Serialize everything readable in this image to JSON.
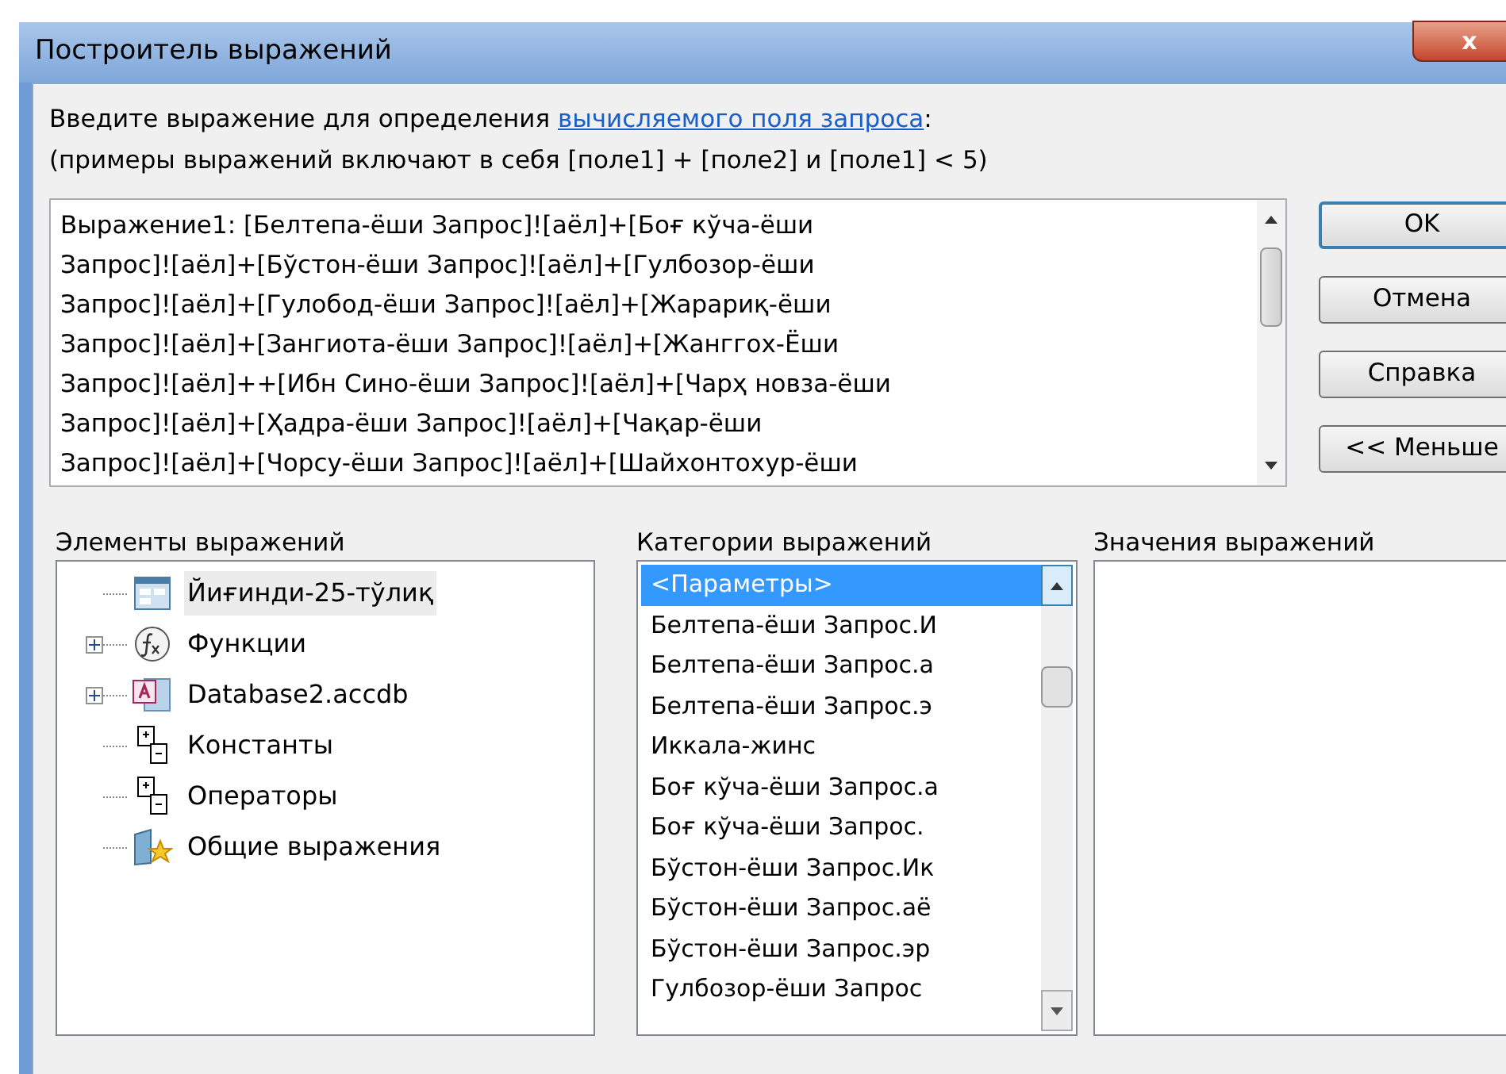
{
  "window": {
    "title": "Построитель выражений",
    "close": "x"
  },
  "instruction": {
    "before": "Введите выражение для определения ",
    "link": "вычисляемого поля запроса",
    "after": ":"
  },
  "example": "(примеры выражений включают в себя [поле1] + [поле2] и [поле1] < 5)",
  "expression_lines": [
    "Выражение1: [Белтепа-ёши Запрос]![аёл]+[Боғ кўча-ёши",
    "Запрос]![аёл]+[Бўстон-ёши Запрос]![аёл]+[Гулбозор-ёши",
    "Запрос]![аёл]+[Гулобод-ёши Запрос]![аёл]+[Жарариқ-ёши",
    "Запрос]![аёл]+[Зангиота-ёши Запрос]![аёл]+[Жанггох-Ёши",
    "Запрос]![аёл]++[Ибн Сино-ёши Запрос]![аёл]+[Чарҳ новза-ёши",
    "Запрос]![аёл]+[Ҳадра-ёши Запрос]![аёл]+[Чақар-ёши",
    "Запрос]![аёл]+[Чорсу-ёши Запрос]![аёл]+[Шайхонтохур-ёши"
  ],
  "buttons": [
    {
      "label": "OK",
      "default": true
    },
    {
      "label": "Отмена",
      "default": false
    },
    {
      "label": "Справка",
      "default": false
    },
    {
      "label": "<< Меньше",
      "default": false
    }
  ],
  "elements": {
    "label": "Элементы выражений",
    "items": [
      {
        "label": "Йиғинди-25-тўлиқ",
        "kind": "form",
        "expandable": false,
        "selected": true
      },
      {
        "label": "Функции",
        "kind": "function",
        "expandable": true,
        "selected": false
      },
      {
        "label": "Database2.accdb",
        "kind": "database",
        "expandable": true,
        "selected": false
      },
      {
        "label": "Константы",
        "kind": "constants",
        "expandable": false,
        "selected": false
      },
      {
        "label": "Операторы",
        "kind": "constants",
        "expandable": false,
        "selected": false
      },
      {
        "label": "Общие выражения",
        "kind": "common",
        "expandable": false,
        "selected": false
      }
    ]
  },
  "categories": {
    "label": "Категории выражений",
    "items": [
      {
        "label": "<Параметры>",
        "selected": true
      },
      {
        "label": "Белтепа-ёши Запрос.И",
        "selected": false
      },
      {
        "label": "Белтепа-ёши Запрос.а",
        "selected": false
      },
      {
        "label": "Белтепа-ёши Запрос.э",
        "selected": false
      },
      {
        "label": "Иккала-жинс",
        "selected": false
      },
      {
        "label": "Боғ кўча-ёши Запрос.а",
        "selected": false
      },
      {
        "label": "Боғ кўча-ёши Запрос.",
        "selected": false
      },
      {
        "label": "Бўстон-ёши Запрос.Ик",
        "selected": false
      },
      {
        "label": "Бўстон-ёши Запрос.аё",
        "selected": false
      },
      {
        "label": "Бўстон-ёши Запрос.эр",
        "selected": false
      },
      {
        "label": "Гулбозор-ёши Запрос",
        "selected": false
      }
    ]
  },
  "values": {
    "label": "Значения выражений"
  }
}
